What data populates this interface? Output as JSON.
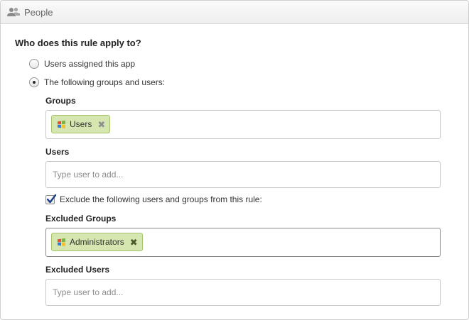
{
  "header": {
    "title": "People",
    "icon": "people-icon"
  },
  "question": "Who does this rule apply to?",
  "options": {
    "assigned_label": "Users assigned this app",
    "following_label": "The following groups and users:",
    "selected": "following"
  },
  "groups": {
    "label": "Groups",
    "tags": [
      "Users"
    ]
  },
  "users": {
    "label": "Users",
    "placeholder": "Type user to add..."
  },
  "exclude": {
    "label": "Exclude the following users and groups from this rule:",
    "checked": true
  },
  "excluded_groups": {
    "label": "Excluded Groups",
    "tags": [
      "Administrators"
    ]
  },
  "excluded_users": {
    "label": "Excluded Users",
    "placeholder": "Type user to add..."
  },
  "colors": {
    "tag_bg": "#d6e6b0",
    "tag_border": "#a7c46c"
  },
  "icons": {
    "group_tag": "windows-logo-icon",
    "remove": "close-icon"
  }
}
